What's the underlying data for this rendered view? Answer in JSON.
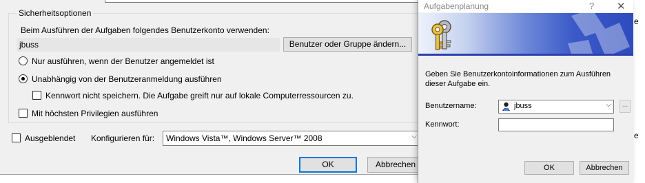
{
  "properties": {
    "group_title": "Sicherheitsoptionen",
    "account_prompt": "Beim Ausführen der Aufgaben folgendes Benutzerkonto verwenden:",
    "account_value": "jbuss",
    "change_user_button": "Benutzer oder Gruppe ändern...",
    "radio_logged_on": "Nur ausführen, wenn der Benutzer angemeldet ist",
    "radio_independent": "Unabhängig von der Benutzeranmeldung ausführen",
    "radio_selected": "independent",
    "checkbox_no_password": "Kennwort nicht speichern. Die Aufgabe greift nur auf lokale Computerressourcen zu.",
    "checkbox_highest_priv": "Mit höchsten Privilegien ausführen",
    "checkbox_hidden": "Ausgeblendet",
    "configure_label": "Konfigurieren für:",
    "configure_value": "Windows Vista™, Windows Server™ 2008",
    "ok_button": "OK",
    "cancel_button": "Abbrechen"
  },
  "dialog": {
    "title": "Aufgabenplanung",
    "help_glyph": "?",
    "close_glyph": "✕",
    "info_text": "Geben Sie Benutzerkontoinformationen zum Ausführen dieser Aufgabe ein.",
    "username_label": "Benutzername:",
    "username_value": "jbuss",
    "browse_glyph": "...",
    "password_label": "Kennwort:",
    "password_value": "",
    "ok_button": "OK",
    "cancel_button": "Abbrechen",
    "banner_icon": "keys-icon"
  },
  "right_edge": {
    "text_1": "e",
    "text_2": "e"
  },
  "colors": {
    "accent": "#0078d7",
    "banner_dark": "#2e4bbd",
    "banner_light": "#eef2fb"
  }
}
